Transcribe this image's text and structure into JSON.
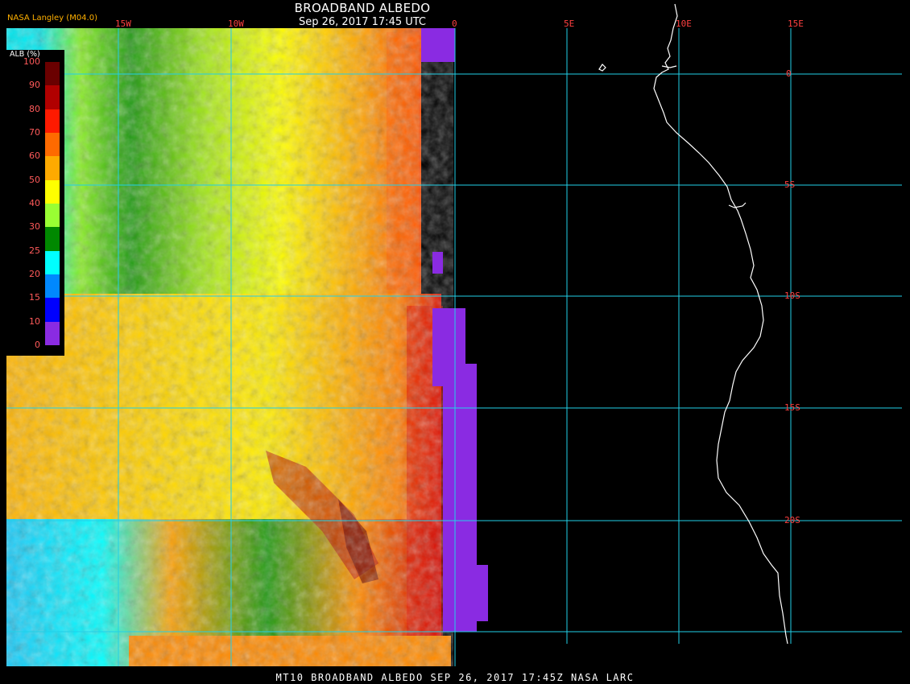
{
  "title": "BROADBAND ALBEDO",
  "timestamp": "Sep 26, 2017 17:45 UTC",
  "source": "NASA Langley (M04.0)",
  "footer": "MT10  BROADBAND ALBEDO   SEP 26, 2017 17:45Z   NASA LARC",
  "legend": {
    "title": "ALB (%)",
    "ticks": [
      "100",
      "90",
      "80",
      "70",
      "60",
      "50",
      "40",
      "30",
      "25",
      "20",
      "15",
      "10",
      "0"
    ],
    "colors": [
      "#6a0000",
      "#b00000",
      "#ff1a00",
      "#ff6a00",
      "#ffaa00",
      "#ffff00",
      "#99ff33",
      "#008800",
      "#00ffff",
      "#0088ff",
      "#0000ff",
      "#8a2be2"
    ]
  },
  "grid": {
    "lon_labels": [
      "15W",
      "10W",
      "0",
      "5E",
      "10E",
      "15E"
    ],
    "lat_labels": [
      "0",
      "5S",
      "10S",
      "15S",
      "20S"
    ],
    "line_color": "#22d0e8"
  }
}
